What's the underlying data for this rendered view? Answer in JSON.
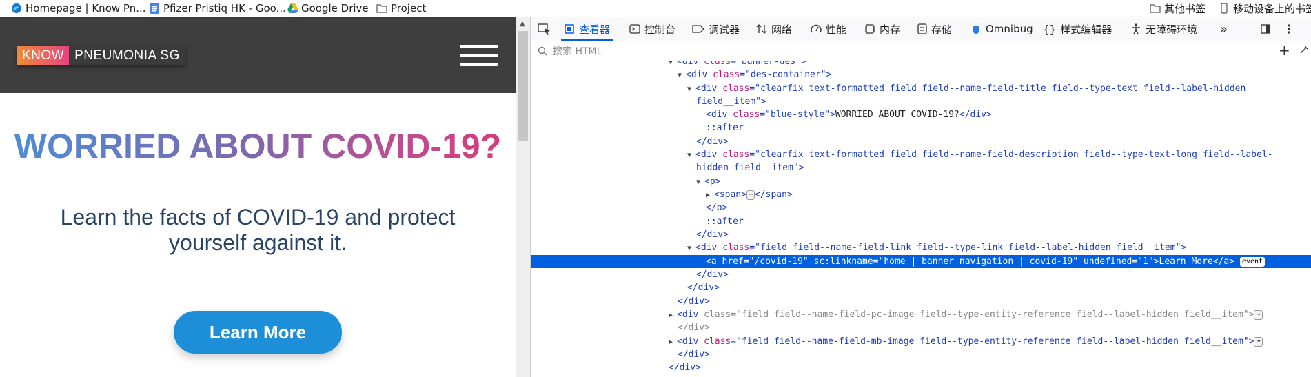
{
  "bookmarks": [
    {
      "label": "Homepage | Know Pn...",
      "icon": "edge-icon"
    },
    {
      "label": "Pfizer Pristiq HK - Goo...",
      "icon": "doc-icon"
    },
    {
      "label": "Google Drive",
      "icon": "drive-icon"
    },
    {
      "label": "Project",
      "icon": "folder-icon"
    },
    {
      "label": "其他书签",
      "icon": "folder-icon"
    },
    {
      "label": "移动设备上的书签",
      "icon": "mobile-icon"
    }
  ],
  "site": {
    "logo_know": "KNOW",
    "logo_pneumonia": "PNEUMONIA SG",
    "headline": "WORRIED ABOUT COVID-19?",
    "subtext": "Learn the facts of COVID-19 and protect yourself against it.",
    "cta": "Learn More"
  },
  "devtools": {
    "tabs": [
      {
        "label": "查看器",
        "icon": "inspector-icon",
        "active": true
      },
      {
        "label": "控制台",
        "icon": "console-icon"
      },
      {
        "label": "调试器",
        "icon": "debugger-icon"
      },
      {
        "label": "网络",
        "icon": "network-icon"
      },
      {
        "label": "性能",
        "icon": "performance-icon"
      },
      {
        "label": "内存",
        "icon": "memory-icon"
      },
      {
        "label": "存储",
        "icon": "storage-icon"
      },
      {
        "label": "Omnibug",
        "icon": "omnibug-icon"
      },
      {
        "label": "样式编辑器",
        "icon": "style-editor-icon"
      },
      {
        "label": "无障碍环境",
        "icon": "accessibility-icon"
      }
    ],
    "search_placeholder": "搜索 HTML",
    "html_lines": {
      "l0_class": "banner-des",
      "l1_class": "des-container",
      "l2_class": "clearfix text-formatted field field--name-field-title field--type-text field--label-hidden",
      "l2_wrap": "field__item",
      "l3_class": "blue-style",
      "l3_text": "WORRIED ABOUT COVID-19?",
      "after": "::after",
      "l6_class": "clearfix text-formatted field field--name-field-description field--type-text-long field--label-",
      "l6_wrap": "hidden field__item",
      "l12_class": "field field--name-field-link field--type-link field--label-hidden field__item",
      "l13_href": "/covid-19",
      "l13_linkname": "home | banner navigation | covid-19",
      "l13_undefined": "1",
      "l13_text": "Learn More",
      "event": "event",
      "l17_class": "field field--name-field-pc-image field--type-entity-reference field--label-hidden field__item",
      "l19_class": "field field--name-field-mb-image field--type-entity-reference field--label-hidden field__item"
    }
  }
}
